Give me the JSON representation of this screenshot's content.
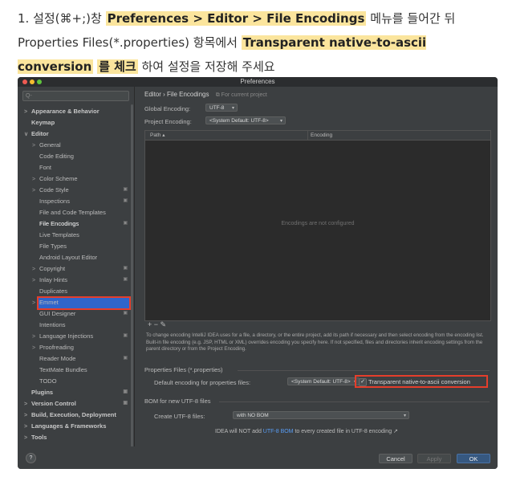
{
  "instruction": {
    "prefix": "1. 설정(⌘+;)창",
    "path": "Preferences > Editor > File Encodings",
    "mid": "메뉴를 들어간 뒤 Properties Files(*.properties) 항목에서",
    "option": "Transparent native-to-ascii conversion",
    "check": "를 체크",
    "suffix": "하여 설정을 저장해 주세요"
  },
  "window": {
    "title": "Preferences"
  },
  "search": {
    "placeholder": "Q-"
  },
  "sidebar": {
    "items": [
      {
        "label": "Appearance & Behavior",
        "arrow": ">",
        "bold": true,
        "gear": false
      },
      {
        "label": "Keymap",
        "arrow": "",
        "bold": true,
        "gear": false
      },
      {
        "label": "Editor",
        "arrow": "∨",
        "bold": true,
        "gear": false
      },
      {
        "label": "General",
        "arrow": ">",
        "bold": false,
        "gear": false
      },
      {
        "label": "Code Editing",
        "arrow": "",
        "bold": false,
        "gear": false
      },
      {
        "label": "Font",
        "arrow": "",
        "bold": false,
        "gear": false
      },
      {
        "label": "Color Scheme",
        "arrow": ">",
        "bold": false,
        "gear": false
      },
      {
        "label": "Code Style",
        "arrow": ">",
        "bold": false,
        "gear": true
      },
      {
        "label": "Inspections",
        "arrow": "",
        "bold": false,
        "gear": true
      },
      {
        "label": "File and Code Templates",
        "arrow": "",
        "bold": false,
        "gear": false
      },
      {
        "label": "File Encodings",
        "arrow": "",
        "bold": false,
        "gear": true,
        "selected": true
      },
      {
        "label": "Live Templates",
        "arrow": "",
        "bold": false,
        "gear": false
      },
      {
        "label": "File Types",
        "arrow": "",
        "bold": false,
        "gear": false
      },
      {
        "label": "Android Layout Editor",
        "arrow": "",
        "bold": false,
        "gear": false
      },
      {
        "label": "Copyright",
        "arrow": ">",
        "bold": false,
        "gear": true
      },
      {
        "label": "Inlay Hints",
        "arrow": ">",
        "bold": false,
        "gear": true
      },
      {
        "label": "Duplicates",
        "arrow": "",
        "bold": false,
        "gear": false
      },
      {
        "label": "Emmet",
        "arrow": ">",
        "bold": false,
        "gear": false
      },
      {
        "label": "GUI Designer",
        "arrow": "",
        "bold": false,
        "gear": true
      },
      {
        "label": "Intentions",
        "arrow": "",
        "bold": false,
        "gear": false
      },
      {
        "label": "Language Injections",
        "arrow": ">",
        "bold": false,
        "gear": true
      },
      {
        "label": "Proofreading",
        "arrow": ">",
        "bold": false,
        "gear": false
      },
      {
        "label": "Reader Mode",
        "arrow": "",
        "bold": false,
        "gear": true
      },
      {
        "label": "TextMate Bundles",
        "arrow": "",
        "bold": false,
        "gear": false
      },
      {
        "label": "TODO",
        "arrow": "",
        "bold": false,
        "gear": false
      },
      {
        "label": "Plugins",
        "arrow": "",
        "bold": true,
        "gear": true
      },
      {
        "label": "Version Control",
        "arrow": ">",
        "bold": true,
        "gear": true
      },
      {
        "label": "Build, Execution, Deployment",
        "arrow": ">",
        "bold": true,
        "gear": false
      },
      {
        "label": "Languages & Frameworks",
        "arrow": ">",
        "bold": true,
        "gear": false
      },
      {
        "label": "Tools",
        "arrow": ">",
        "bold": true,
        "gear": false
      }
    ]
  },
  "main": {
    "breadcrumb": "Editor  ›  File Encodings",
    "breadcrumb_scope": "For current project",
    "global_label": "Global Encoding:",
    "global_value": "UTF-8",
    "project_label": "Project Encoding:",
    "project_value": "<System Default: UTF-8>",
    "col_path": "Path",
    "col_encoding": "Encoding",
    "empty_text": "Encodings are not configured",
    "table_tools": "+  −  ✎",
    "description": "To change encoding IntelliJ IDEA uses for a file, a directory, or the entire project, add its path if necessary and then select encoding from the encoding list. Built-in file encoding (e.g. JSP, HTML or XML) overrides encoding you specify here. If not specified, files and directories inherit encoding settings from the parent directory or from the Project Encoding.",
    "props_section": "Properties Files (*.properties)",
    "props_label": "Default encoding for properties files:",
    "props_value": "<System Default: UTF-8>",
    "native_label": "Transparent native-to-ascii conversion",
    "native_checked": true,
    "bom_section": "BOM for new UTF-8 files",
    "bom_label": "Create UTF-8 files:",
    "bom_value": "with NO BOM",
    "bom_note_pre": "IDEA will NOT add",
    "bom_note_link": "UTF-8 BOM",
    "bom_note_post": "to every created file in UTF-8 encoding ↗"
  },
  "footer": {
    "help": "?",
    "cancel": "Cancel",
    "apply": "Apply",
    "ok": "OK"
  },
  "colors": {
    "accent": "#2f65ca",
    "highlight_border": "#e53e2b",
    "ok_button": "#365880"
  }
}
